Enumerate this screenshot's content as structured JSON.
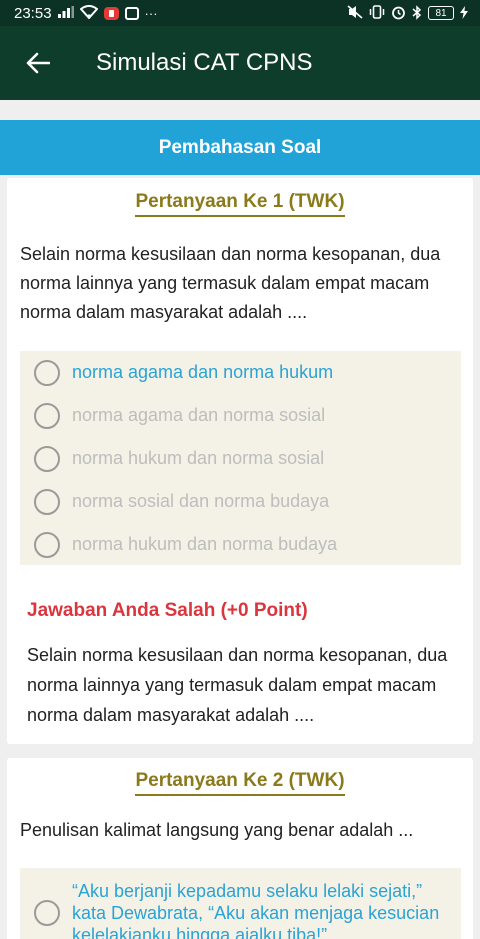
{
  "status_bar": {
    "time": "23:53",
    "ellipsis": "···",
    "battery": "81"
  },
  "app_bar": {
    "title": "Simulasi CAT CPNS"
  },
  "section": {
    "title": "Pembahasan Soal"
  },
  "questions": [
    {
      "title": "Pertanyaan Ke 1 (TWK)",
      "text": "Selain norma kesusilaan dan norma kesopanan, dua norma lainnya yang termasuk dalam empat macam norma dalam masyarakat adalah ....",
      "options": [
        "norma agama dan norma hukum",
        "norma agama dan norma sosial",
        "norma hukum dan norma sosial",
        "norma sosial dan norma budaya",
        "norma hukum dan norma budaya"
      ],
      "result": "Jawaban Anda Salah (+0 Point)",
      "explanation": "Selain norma kesusilaan dan norma kesopanan, dua norma lainnya yang termasuk dalam empat macam norma dalam masyarakat adalah ...."
    },
    {
      "title": "Pertanyaan Ke 2 (TWK)",
      "text": "Penulisan kalimat langsung yang benar adalah ...",
      "options": [
        "“Aku berjanji kepadamu selaku lelaki sejati,” kata Dewabrata, “Aku akan menjaga kesucian kelelakianku hingga ajalku tiba!”"
      ]
    }
  ],
  "colors": {
    "app_bar": "#0f3d2c",
    "section_header": "#22a3d8",
    "question_title": "#8a7a1b",
    "correct_option": "#2aa3d5",
    "wrong_result": "#d9363e"
  }
}
